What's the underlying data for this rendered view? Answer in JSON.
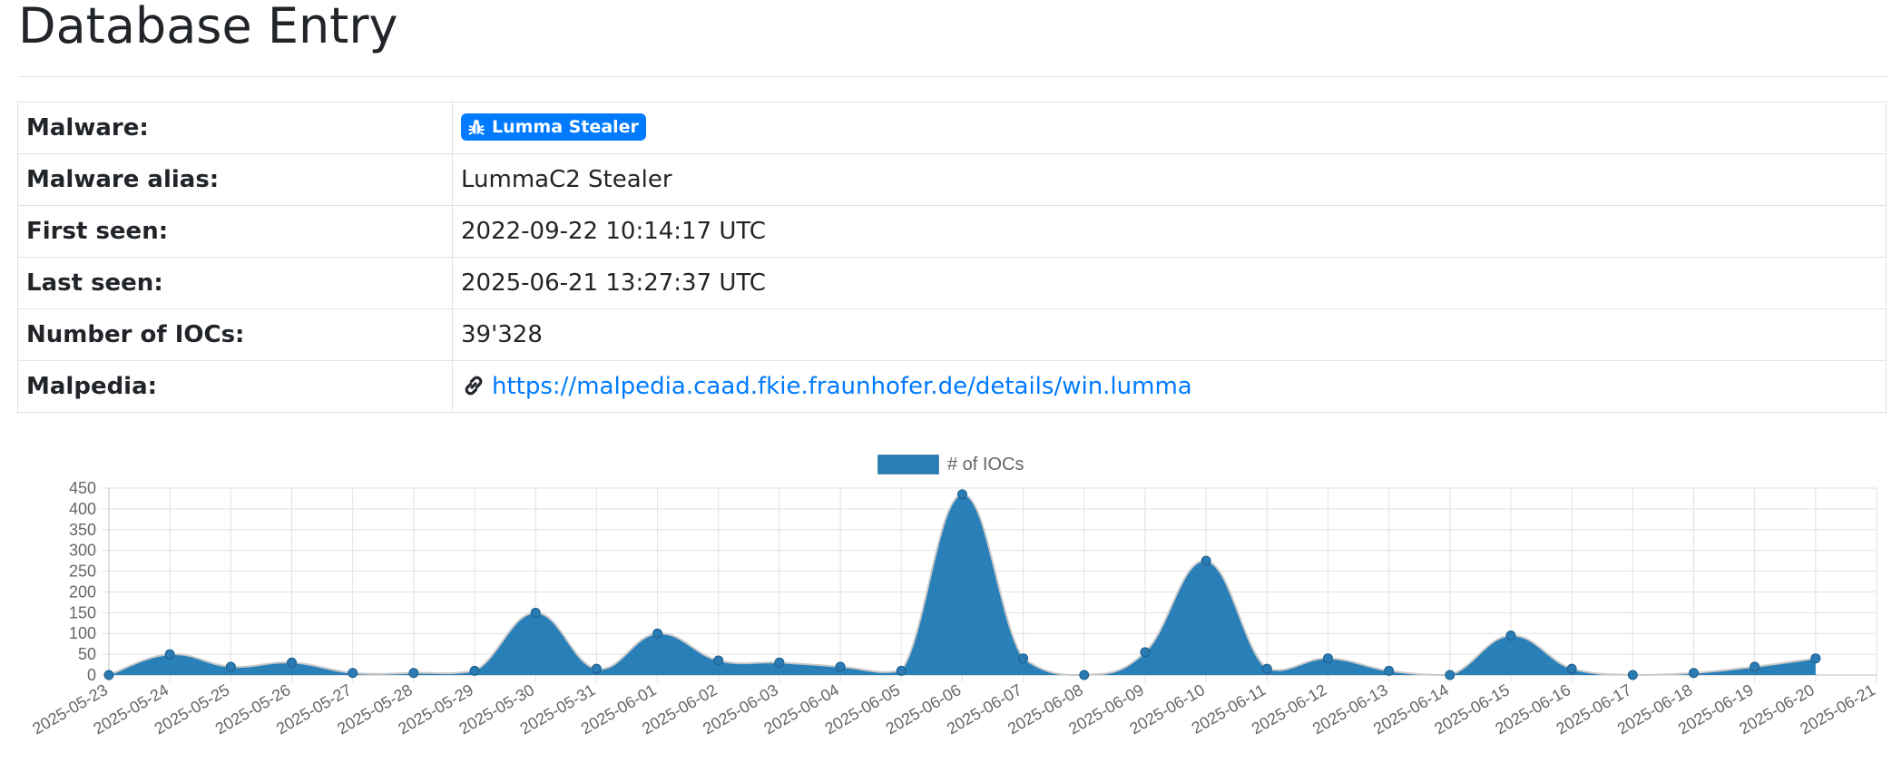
{
  "page": {
    "title": "Database Entry"
  },
  "info": {
    "rows": [
      {
        "key": "Malware:",
        "value": "Lumma Stealer",
        "kind": "badge"
      },
      {
        "key": "Malware alias:",
        "value": "LummaC2 Stealer",
        "kind": "text"
      },
      {
        "key": "First seen:",
        "value": "2022-09-22 10:14:17 UTC",
        "kind": "text"
      },
      {
        "key": "Last seen:",
        "value": "2025-06-21 13:27:37 UTC",
        "kind": "text"
      },
      {
        "key": "Number of IOCs:",
        "value": "39'328",
        "kind": "text"
      },
      {
        "key": "Malpedia:",
        "value": "https://malpedia.caad.fkie.fraunhofer.de/details/win.lumma",
        "kind": "link"
      }
    ],
    "badge_color": "#007bff",
    "badge_icon": "bug-icon",
    "link_icon": "link-icon"
  },
  "chart_data": {
    "type": "area",
    "legend": [
      "# of IOCs"
    ],
    "legend_position": "top",
    "grid": true,
    "ylim": [
      0,
      450
    ],
    "yticks": [
      0,
      50,
      100,
      150,
      200,
      250,
      300,
      350,
      400,
      450
    ],
    "fill_color": "#2980b9",
    "x": [
      "2025-05-23",
      "2025-05-24",
      "2025-05-25",
      "2025-05-26",
      "2025-05-27",
      "2025-05-28",
      "2025-05-29",
      "2025-05-30",
      "2025-05-31",
      "2025-06-01",
      "2025-06-02",
      "2025-06-03",
      "2025-06-04",
      "2025-06-05",
      "2025-06-06",
      "2025-06-07",
      "2025-06-08",
      "2025-06-09",
      "2025-06-10",
      "2025-06-11",
      "2025-06-12",
      "2025-06-13",
      "2025-06-14",
      "2025-06-15",
      "2025-06-16",
      "2025-06-17",
      "2025-06-18",
      "2025-06-19",
      "2025-06-20",
      "2025-06-21"
    ],
    "series": [
      {
        "name": "# of IOCs",
        "values": [
          0,
          50,
          20,
          30,
          5,
          5,
          10,
          150,
          15,
          100,
          35,
          30,
          20,
          10,
          435,
          40,
          0,
          55,
          275,
          15,
          40,
          10,
          0,
          95,
          15,
          0,
          5,
          20,
          40
        ]
      }
    ]
  }
}
